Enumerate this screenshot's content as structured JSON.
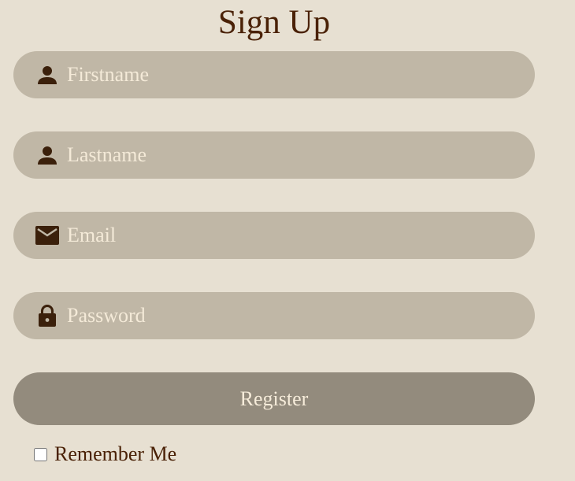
{
  "title": "Sign Up",
  "fields": {
    "firstname": {
      "placeholder": "Firstname",
      "value": "",
      "icon": "user-icon"
    },
    "lastname": {
      "placeholder": "Lastname",
      "value": "",
      "icon": "user-icon"
    },
    "email": {
      "placeholder": "Email",
      "value": "",
      "icon": "envelope-icon"
    },
    "password": {
      "placeholder": "Password",
      "value": "",
      "icon": "lock-icon"
    }
  },
  "register_label": "Register",
  "remember": {
    "label": "Remember Me",
    "checked": false
  },
  "colors": {
    "background": "#e7e0d2",
    "field": "#c0b7a6",
    "button": "#938b7d",
    "text_dark": "#4a2106",
    "placeholder": "#f4ead8"
  }
}
